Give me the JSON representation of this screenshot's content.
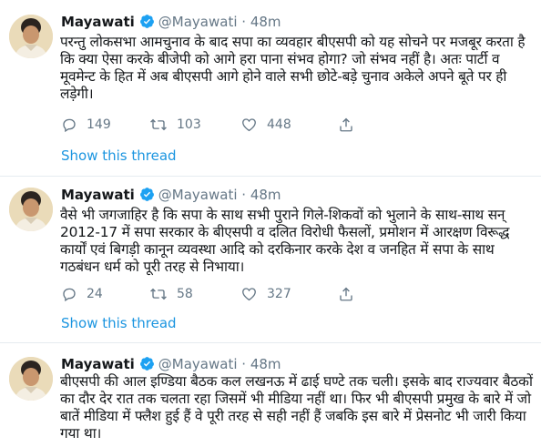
{
  "tweets": [
    {
      "name": "Mayawati",
      "handle": "@Mayawati",
      "time": "48m",
      "text": "परन्तु लोकसभा आमचुनाव के बाद सपा का व्यवहार बीएसपी को यह सोचने पर मजबूर करता है कि क्या ऐसा करके बीजेपी को आगे हरा पाना संभव होगा? जो संभव नहीं है। अतः पार्टी व मूवमेन्ट के हित में अब बीएसपी आगे होने वाले सभी छोटे-बड़े चुनाव अकेले अपने बूते पर ही लड़ेगी।",
      "replies": "149",
      "retweets": "103",
      "likes": "448",
      "show_thread": "Show this thread"
    },
    {
      "name": "Mayawati",
      "handle": "@Mayawati",
      "time": "48m",
      "text": "वैसे भी जगजाहिर है कि सपा के साथ सभी पुराने गिले-शिकवों को भुलाने के साथ-साथ सन् 2012-17 में सपा सरकार के बीएसपी व दलित विरोधी फैसलों, प्रमोशन में आरक्षण विरूद्ध कार्यों एवं बिगड़ी कानून व्यवस्था आदि को दरकिनार करके देश व जनहित में सपा के साथ गठबंधन धर्म को पूरी तरह से निभाया।",
      "replies": "24",
      "retweets": "58",
      "likes": "327",
      "show_thread": "Show this thread"
    },
    {
      "name": "Mayawati",
      "handle": "@Mayawati",
      "time": "48m",
      "text": "बीएसपी की आल इण्डिया बैठक कल लखनऊ में ढाई घण्टे तक चली। इसके बाद राज्यवार बैठकों का दौर देर रात तक चलता रहा जिसमें भी मीडिया नहीं था। फिर भी बीएसपी प्रमुख के बारे में जो बातें मीडिया में फ्लैश हुई हैं वे पूरी तरह से सही नहीं हैं जबकि इस बारे में प्रेसनोट भी जारी किया गया था।"
    }
  ],
  "header_separator": "·",
  "icons": {
    "reply": "reply-icon",
    "retweet": "retweet-icon",
    "like": "heart-icon",
    "share": "share-icon",
    "verified": "verified-badge-icon"
  },
  "colors": {
    "link": "#1b95e0",
    "muted": "#657786",
    "verified": "#1da1f2",
    "text": "#14171a"
  }
}
